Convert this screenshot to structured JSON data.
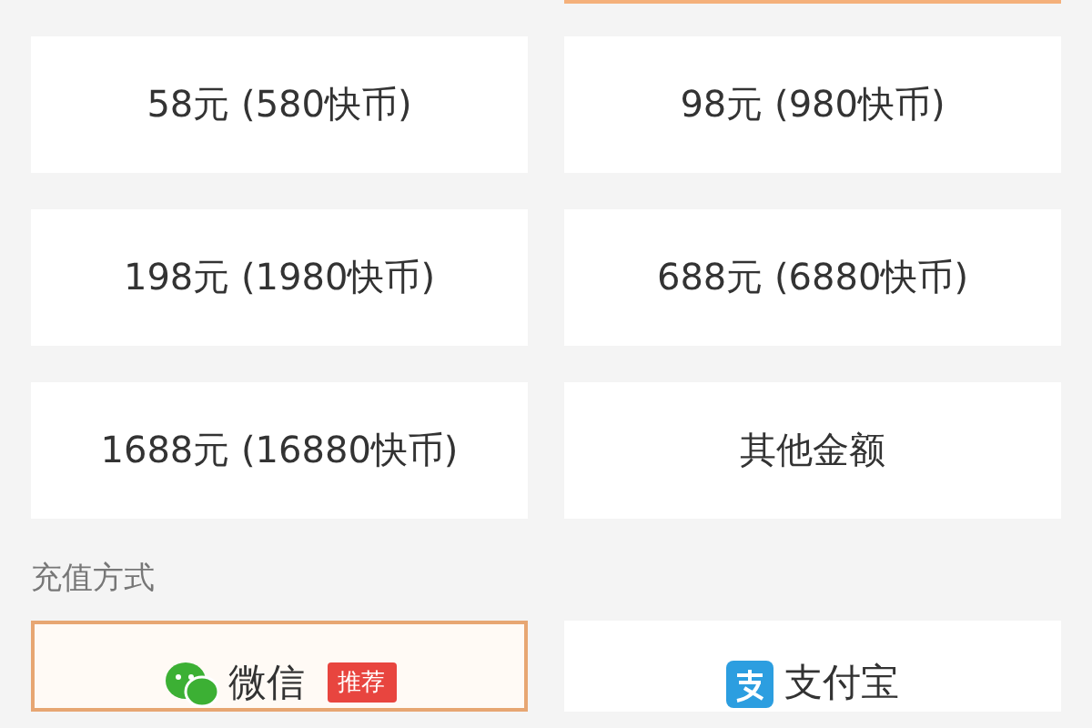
{
  "top_option": {
    "selected": true
  },
  "amount_options": [
    {
      "label": "58元 (580快币)",
      "selected": false
    },
    {
      "label": "98元 (980快币)",
      "selected": false
    },
    {
      "label": "198元 (1980快币)",
      "selected": false
    },
    {
      "label": "688元 (6880快币)",
      "selected": false
    },
    {
      "label": "1688元 (16880快币)",
      "selected": false
    },
    {
      "label": "其他金额",
      "selected": false
    }
  ],
  "payment_section_title": "充值方式",
  "payment_methods": [
    {
      "kind": "wechat",
      "label": "微信",
      "badge": "推荐",
      "selected": true
    },
    {
      "kind": "alipay",
      "label": "支付宝",
      "selected": false
    }
  ]
}
